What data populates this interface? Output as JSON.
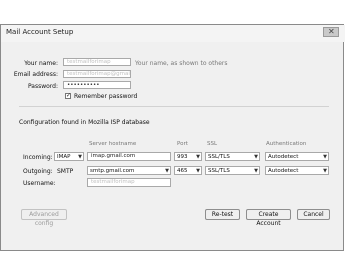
{
  "window": {
    "title": "Mail Account Setup"
  },
  "form": {
    "name_label": "Your name:",
    "name_value": "testmailforimap",
    "name_hint": "Your name, as shown to others",
    "email_label": "Email address:",
    "email_value": "testmailforimap@gmail.com",
    "password_label": "Password:",
    "password_value": "••••••••••",
    "remember_label": "Remember password",
    "remember_checked": true
  },
  "config": {
    "heading": "Configuration found in Mozilla ISP database",
    "headers": {
      "server": "Server hostname",
      "port": "Port",
      "ssl": "SSL",
      "auth": "Authentication"
    },
    "incoming": {
      "label": "Incoming:",
      "protocol": "IMAP",
      "host": "imap.gmail.com",
      "port": "993",
      "ssl": "SSL/TLS",
      "auth": "Autodetect"
    },
    "outgoing": {
      "label": "Outgoing:",
      "protocol": "SMTP",
      "host": "smtp.gmail.com",
      "port": "465",
      "ssl": "SSL/TLS",
      "auth": "Autodetect"
    },
    "username_label": "Username:",
    "username_value": "testmailforimap"
  },
  "buttons": {
    "advanced": "Advanced config",
    "retest": "Re-test",
    "create": "Create Account",
    "cancel": "Cancel"
  },
  "icons": {
    "close": "close-icon",
    "dropdown": "dropdown-arrow-icon",
    "check": "checkmark-icon"
  }
}
